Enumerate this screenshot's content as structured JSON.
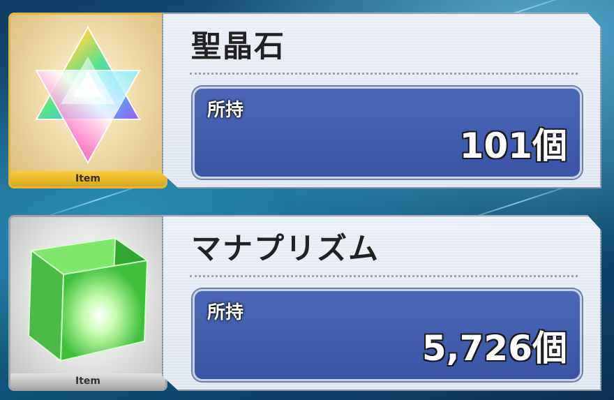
{
  "items": [
    {
      "name": "聖晶石",
      "owned_label": "所持",
      "count": "101個",
      "tag": "Item",
      "icon": "saint-quartz-icon",
      "frame_color": "#e1b640"
    },
    {
      "name": "マナプリズム",
      "owned_label": "所持",
      "count": "5,726個",
      "tag": "Item",
      "icon": "mana-prism-icon",
      "frame_color": "#9ea4ab"
    }
  ]
}
